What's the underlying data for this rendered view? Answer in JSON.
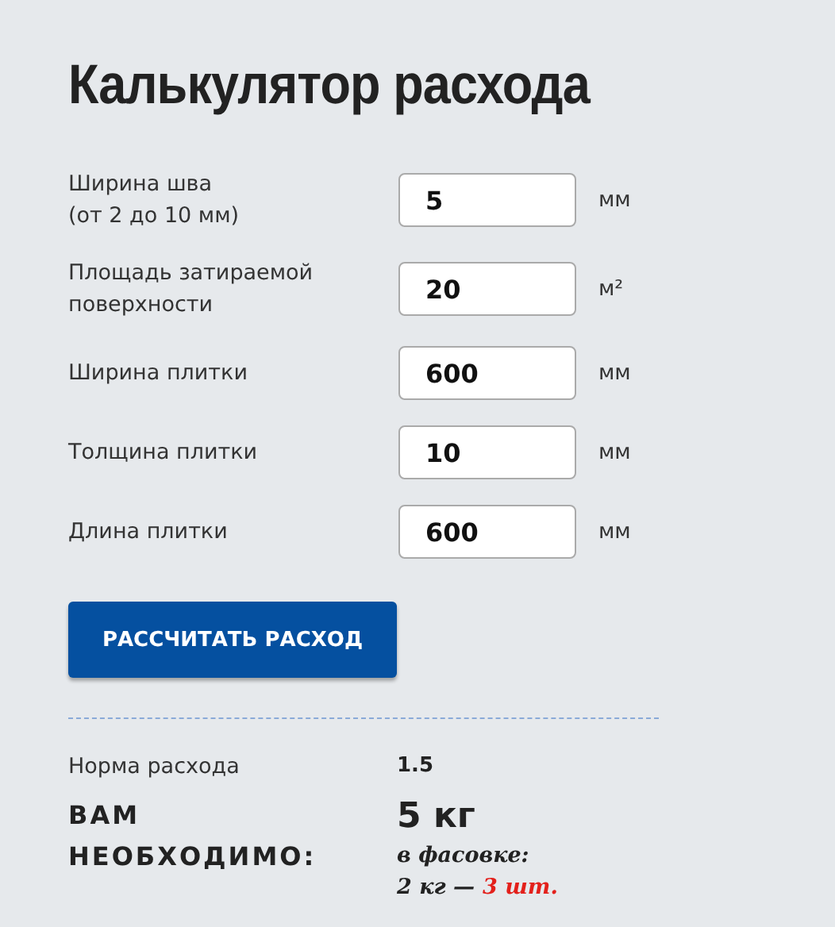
{
  "title": "Калькулятор расхода",
  "fields": [
    {
      "label": "Ширина шва\n(от 2 до 10 мм)",
      "value": "5",
      "unit": "мм"
    },
    {
      "label": "Площадь затираемой поверхности",
      "value": "20",
      "unit": "м²"
    },
    {
      "label": "Ширина плитки",
      "value": "600",
      "unit": "мм"
    },
    {
      "label": "Толщина плитки",
      "value": "10",
      "unit": "мм"
    },
    {
      "label": "Длина плитки",
      "value": "600",
      "unit": "мм"
    }
  ],
  "button": "РАССЧИТАТЬ РАСХОД",
  "result": {
    "rate_label": "Норма расхода",
    "rate_value": "1.5",
    "need_label": "ВАМ НЕОБХОДИМО:",
    "need_value": "5 кг",
    "packaging_label": "в фасовке:",
    "package_size": "2 кг —",
    "package_count": "3 шт."
  }
}
